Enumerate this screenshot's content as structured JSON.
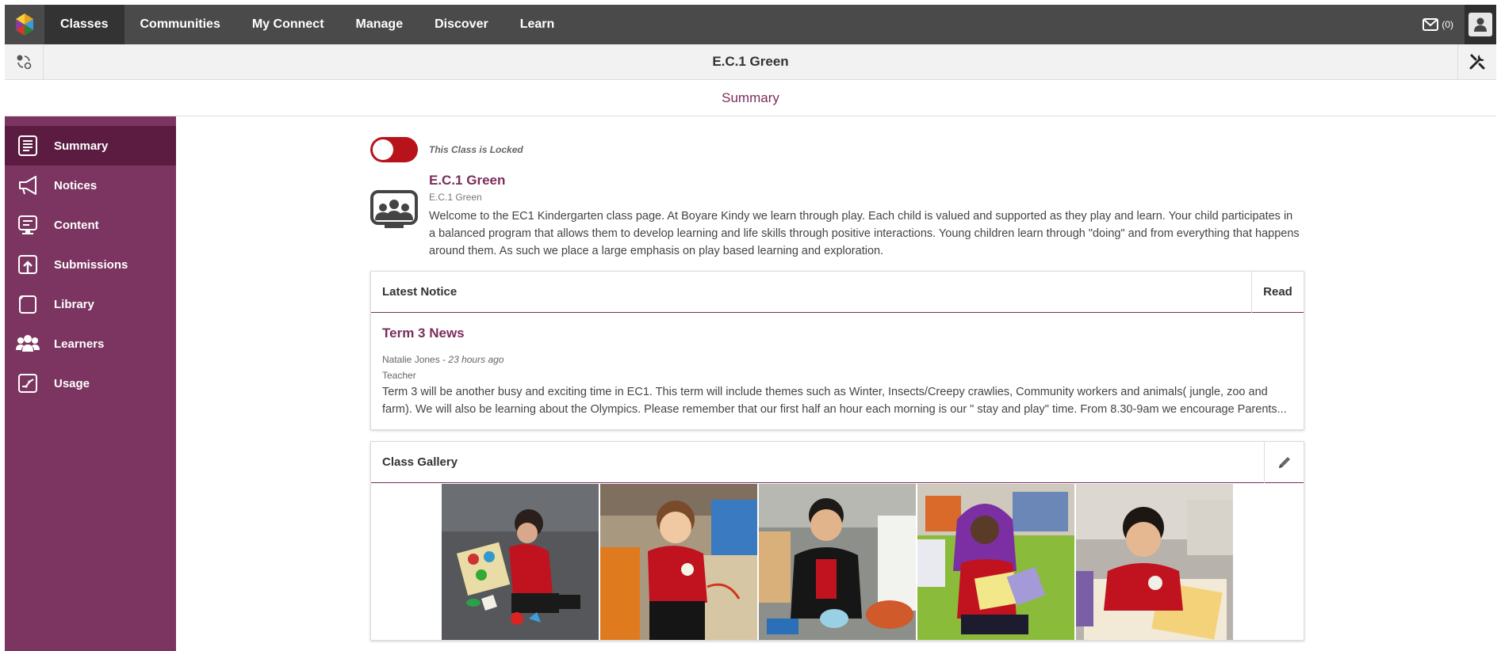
{
  "nav": {
    "items": [
      {
        "label": "Classes",
        "active": true
      },
      {
        "label": "Communities"
      },
      {
        "label": "My Connect"
      },
      {
        "label": "Manage"
      },
      {
        "label": "Discover"
      },
      {
        "label": "Learn"
      }
    ],
    "mail_count": "(0)"
  },
  "class_bar": {
    "title": "E.C.1 Green"
  },
  "page": {
    "section": "Summary"
  },
  "sidebar": {
    "items": [
      {
        "label": "Summary",
        "icon": "summary-icon",
        "active": true
      },
      {
        "label": "Notices",
        "icon": "megaphone-icon"
      },
      {
        "label": "Content",
        "icon": "content-icon"
      },
      {
        "label": "Submissions",
        "icon": "upload-icon"
      },
      {
        "label": "Library",
        "icon": "library-icon"
      },
      {
        "label": "Learners",
        "icon": "learners-icon"
      },
      {
        "label": "Usage",
        "icon": "usage-chart-icon"
      }
    ]
  },
  "class": {
    "lock_label": "This Class is Locked",
    "name": "E.C.1 Green",
    "code": "E.C.1 Green",
    "description": "Welcome to the EC1 Kindergarten class page. At Boyare Kindy we learn through play. Each child is valued and supported as they play and learn. Your child participates in a balanced program that allows them to develop learning and life skills through positive interactions. Young children learn through \"doing\" and from everything that happens around them. As such we place a large emphasis on play based learning and exploration."
  },
  "latest_notice": {
    "header": "Latest Notice",
    "action": "Read",
    "title": "Term 3 News",
    "author": "Natalie Jones",
    "separator": "-",
    "time": "23 hours ago",
    "role": "Teacher",
    "text": "Term 3 will be another busy and exciting time in EC1. This term will include themes such as Winter, Insects/Creepy crawlies, Community workers and animals( jungle, zoo and farm). We will also be learning about the Olympics. Please remember that our first half an hour each morning is our \" stay and play\" time. From 8.30-9am we encourage Parents..."
  },
  "gallery": {
    "header": "Class Gallery",
    "photos": [
      "photo-1",
      "photo-2",
      "photo-3",
      "photo-4",
      "photo-5"
    ]
  },
  "colors": {
    "brand": "#7b2d5c",
    "sidebar": "#7b3560",
    "sidebar_active": "#5c1c42",
    "topnav": "#4a4a4a",
    "toggle": "#b8121b"
  }
}
